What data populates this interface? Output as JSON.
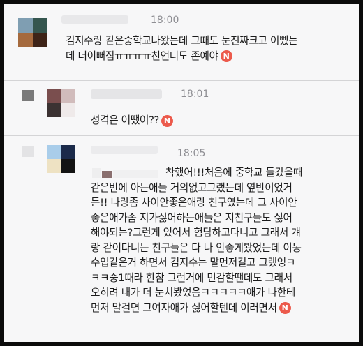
{
  "comments": [
    {
      "time": "18:00",
      "lines": [
        "김지수랑 같은중학교나왔는데 그때도 눈진짜크고 이뻤는",
        "데 더이뻐짐ㅠㅠㅠㅠ친언니도 존예야"
      ],
      "badge": "N"
    },
    {
      "time": "18:01",
      "lines": [
        "성격은 어땠어??"
      ],
      "badge": "N"
    },
    {
      "time": "18:05",
      "lines": [
        "착했어!!!처음에 중학교 들갔을때",
        "같은반에 아는애들 거의없고그랬는데 옆반이었거",
        "든!! 나랑좀 사이안좋은애랑 친구였는데 그 사이안",
        "좋은애가좀 지가싫어하는애들은 지친구들도 싫어",
        "해야되는?그런게 있어서 험담하고다니고 그래서 걔",
        "랑 같이다니는 친구들은 다 나 안좋게봤었는데 이동",
        "수업같은거 하면서 김지수는 말먼저걸고 그랬엉ㅋ",
        "ㅋㅋ중1때라 한참 그런거에 민감할땐데도 그래서",
        "오히려 내가 더 눈치봤었음ㅋㅋㅋㅋㅋ애가 나한테",
        "먼저 말걸면 그여자애가 싫어할텐데 이러면서"
      ],
      "badge": "N"
    }
  ]
}
